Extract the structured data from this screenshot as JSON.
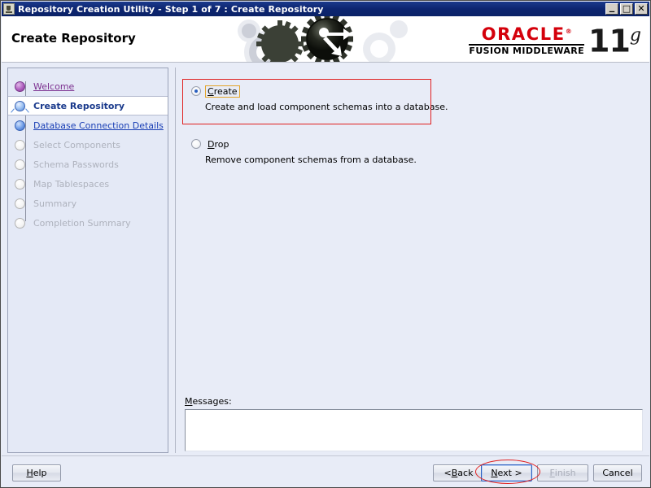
{
  "window": {
    "title": "Repository Creation Utility - Step 1 of 7 : Create Repository",
    "icon": "java-coffee-cup-icon",
    "minimize_label": "_",
    "maximize_label": "□",
    "close_label": "✕"
  },
  "header": {
    "page_title": "Create Repository",
    "brand": {
      "oracle": "ORACLE",
      "trademark": "®",
      "product_line": "FUSION MIDDLEWARE",
      "version_number": "11",
      "version_suffix": "g"
    }
  },
  "sidebar": {
    "steps": [
      {
        "label": "Welcome",
        "state": "done"
      },
      {
        "label": "Create Repository",
        "state": "current"
      },
      {
        "label": "Database Connection Details",
        "state": "next"
      },
      {
        "label": "Select Components",
        "state": "todo"
      },
      {
        "label": "Schema Passwords",
        "state": "todo"
      },
      {
        "label": "Map Tablespaces",
        "state": "todo"
      },
      {
        "label": "Summary",
        "state": "todo"
      },
      {
        "label": "Completion Summary",
        "state": "todo"
      }
    ]
  },
  "main": {
    "options": [
      {
        "label_pre": "",
        "label_mnemonic": "C",
        "label_post": "reate",
        "label_full": "Create",
        "description": "Create and load component schemas into a database.",
        "selected": true,
        "focused": true
      },
      {
        "label_pre": "",
        "label_mnemonic": "D",
        "label_post": "rop",
        "label_full": "Drop",
        "description": "Remove component schemas from a database.",
        "selected": false,
        "focused": false
      }
    ],
    "messages": {
      "label_mnemonic": "M",
      "label_post": "essages:",
      "label_full": "Messages:",
      "value": ""
    }
  },
  "buttons": {
    "help": {
      "mnemonic": "H",
      "post": "elp",
      "full": "Help",
      "disabled": false,
      "focused": false
    },
    "back": {
      "pre": "< ",
      "mnemonic": "B",
      "post": "ack",
      "full": "< Back",
      "disabled": false,
      "focused": false
    },
    "next": {
      "mnemonic": "N",
      "post": "ext >",
      "full": "Next >",
      "disabled": false,
      "focused": true
    },
    "finish": {
      "mnemonic": "F",
      "post": "inish",
      "full": "Finish",
      "disabled": true,
      "focused": false
    },
    "cancel": {
      "mnemonic": "",
      "post": "Cancel",
      "full": "Cancel",
      "disabled": false,
      "focused": false
    }
  },
  "annotations": {
    "highlight_color": "#e02020",
    "create_option_box": true,
    "next_button_ellipse": true
  }
}
